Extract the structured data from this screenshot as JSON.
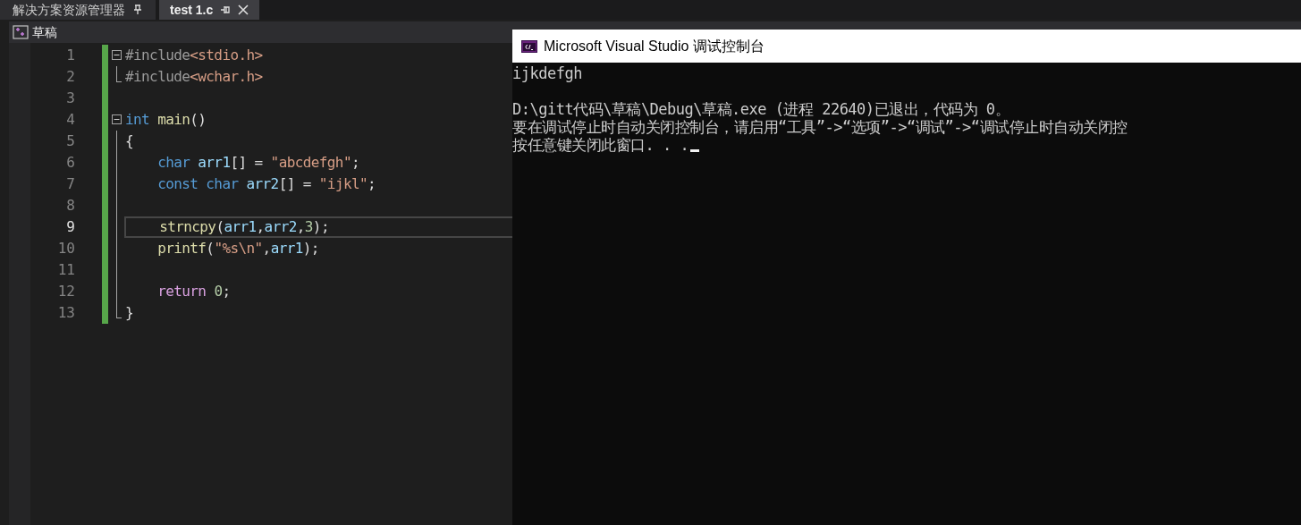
{
  "tabs": [
    {
      "label": "解决方案资源管理器",
      "selected": false
    },
    {
      "label": "test 1.c",
      "selected": true
    }
  ],
  "project": {
    "name": "草稿"
  },
  "editor": {
    "lines": [
      {
        "number": "1",
        "current": false,
        "kind": "block_start",
        "expanded": true,
        "tokens": [
          {
            "kind": "macro",
            "text": "#include"
          },
          {
            "kind": "string",
            "text": "<stdio.h>"
          }
        ]
      },
      {
        "number": "2",
        "current": false,
        "kind": "block_end",
        "tokens": [
          {
            "kind": "macro",
            "text": "#include"
          },
          {
            "kind": "string",
            "text": "<wchar.h>"
          }
        ]
      },
      {
        "number": "3",
        "current": false,
        "kind": "plain"
      },
      {
        "number": "4",
        "current": false,
        "kind": "block_start",
        "expanded": true,
        "tokens": [
          {
            "kind": "keyword",
            "text": "int "
          },
          {
            "kind": "function",
            "text": "main"
          },
          {
            "kind": "plain",
            "text": "()"
          }
        ]
      },
      {
        "number": "5",
        "current": false,
        "kind": "block_body",
        "tokens": [
          {
            "kind": "plain",
            "text": "{"
          }
        ]
      },
      {
        "number": "6",
        "current": false,
        "kind": "block_body",
        "tokens": [
          {
            "kind": "keyword",
            "text": "    char "
          },
          {
            "kind": "variable",
            "text": "arr1"
          },
          {
            "kind": "plain",
            "text": "[] = "
          },
          {
            "kind": "string",
            "text": "\"abcdefgh\""
          },
          {
            "kind": "plain",
            "text": ";"
          }
        ]
      },
      {
        "number": "7",
        "current": false,
        "kind": "block_body",
        "tokens": [
          {
            "kind": "keyword",
            "text": "    const char "
          },
          {
            "kind": "variable",
            "text": "arr2"
          },
          {
            "kind": "plain",
            "text": "[] = "
          },
          {
            "kind": "string",
            "text": "\"ijkl\""
          },
          {
            "kind": "plain",
            "text": ";"
          }
        ]
      },
      {
        "number": "8",
        "current": false,
        "kind": "block_body"
      },
      {
        "number": "9",
        "current": true,
        "kind": "block_body",
        "tokens": [
          {
            "kind": "function",
            "text": "    strncpy"
          },
          {
            "kind": "plain",
            "text": "("
          },
          {
            "kind": "variable",
            "text": "arr1"
          },
          {
            "kind": "plain",
            "text": ","
          },
          {
            "kind": "variable",
            "text": "arr2"
          },
          {
            "kind": "plain",
            "text": ","
          },
          {
            "kind": "number",
            "text": "3"
          },
          {
            "kind": "plain",
            "text": ");"
          }
        ]
      },
      {
        "number": "10",
        "current": false,
        "kind": "block_body",
        "tokens": [
          {
            "kind": "function",
            "text": "    printf"
          },
          {
            "kind": "plain",
            "text": "("
          },
          {
            "kind": "string",
            "text": "\"%s\\n\""
          },
          {
            "kind": "plain",
            "text": ","
          },
          {
            "kind": "variable",
            "text": "arr1"
          },
          {
            "kind": "plain",
            "text": ");"
          }
        ]
      },
      {
        "number": "11",
        "current": false,
        "kind": "block_body"
      },
      {
        "number": "12",
        "current": false,
        "kind": "block_body",
        "tokens": [
          {
            "kind": "control",
            "text": "    return "
          },
          {
            "kind": "number",
            "text": "0"
          },
          {
            "kind": "plain",
            "text": ";"
          }
        ]
      },
      {
        "number": "13",
        "current": false,
        "kind": "block_end",
        "tokens": [
          {
            "kind": "plain",
            "text": "}"
          }
        ]
      }
    ]
  },
  "console": {
    "title": "Microsoft Visual Studio 调试控制台",
    "lines": [
      "ijkdefgh",
      "D:\\gitt代码\\草稿\\Debug\\草稿.exe (进程 22640)已退出，代码为 0。",
      "要在调试停止时自动关闭控制台，请启用“工具”->“选项”->“调试”->“调试停止时自动关闭控",
      "按任意键关闭此窗口. . ."
    ],
    "cursor": true
  }
}
